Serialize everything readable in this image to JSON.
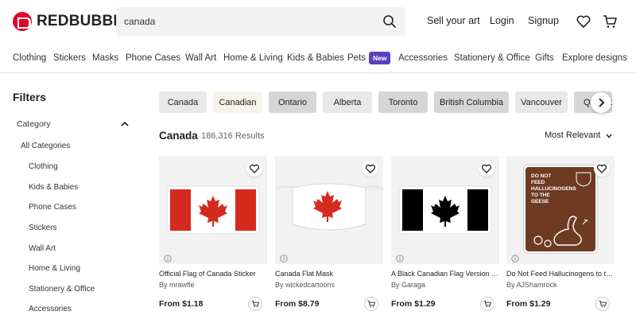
{
  "header": {
    "brand": "REDBUBBLE",
    "search_value": "canada",
    "links": [
      "Sell your art",
      "Login",
      "Signup"
    ]
  },
  "catnav": {
    "items": [
      "Clothing",
      "Stickers",
      "Masks",
      "Phone Cases",
      "Wall Art",
      "Home & Living",
      "Kids & Babies",
      "Pets",
      "Accessories",
      "Stationery & Office",
      "Gifts",
      "Explore designs"
    ],
    "badge": "New"
  },
  "sidebar": {
    "title": "Filters",
    "category_label": "Category",
    "all": "All Categories",
    "items": [
      "Clothing",
      "Kids & Babies",
      "Phone Cases",
      "Stickers",
      "Wall Art",
      "Home & Living",
      "Stationery & Office",
      "Accessories"
    ]
  },
  "chips": [
    {
      "label": "Canada",
      "bg": "#e8e8e8"
    },
    {
      "label": "Canadian",
      "bg": "#f5f3ea"
    },
    {
      "label": "Ontario",
      "bg": "#d6d6d6"
    },
    {
      "label": "Alberta",
      "bg": "#e8e8e8"
    },
    {
      "label": "Toronto",
      "bg": "#d6d6d6"
    },
    {
      "label": "British Columbia",
      "bg": "#d6d6d6"
    },
    {
      "label": "Vancouver",
      "bg": "#e8e8e8"
    },
    {
      "label": "Quebec",
      "bg": "#d6d6d6"
    }
  ],
  "results": {
    "title": "Canada",
    "count": "186,316 Results",
    "sort": "Most Relevant"
  },
  "products": [
    {
      "title": "Official Flag of Canada Sticker",
      "artist": "By mrawfle",
      "price": "From $1.18"
    },
    {
      "title": "Canada Flat Mask",
      "artist": "By wickedcartoons",
      "price": "From $8.79"
    },
    {
      "title": "A Black Canadian Flag Version of the",
      "artist": "By Garaga",
      "price": "From $1.29"
    },
    {
      "title": "Do Not Feed Hallucinogens to the Geese",
      "artist": "By AJShamrock",
      "price": "From $1.29"
    }
  ],
  "sign_text": [
    "DO NOT",
    "FEED",
    "HALLUCINOGENS",
    "TO THE",
    "GEESE"
  ],
  "colors": {
    "brand": "#e4002b",
    "flag_red": "#d52b1e",
    "badge": "#5a3fc0",
    "sign_brown": "#6e3b22"
  },
  "icons": [
    "search-icon",
    "heart-icon",
    "cart-icon",
    "chevron-up-icon",
    "chevron-right-icon",
    "chevron-down-icon",
    "info-icon",
    "add-to-cart-icon"
  ]
}
